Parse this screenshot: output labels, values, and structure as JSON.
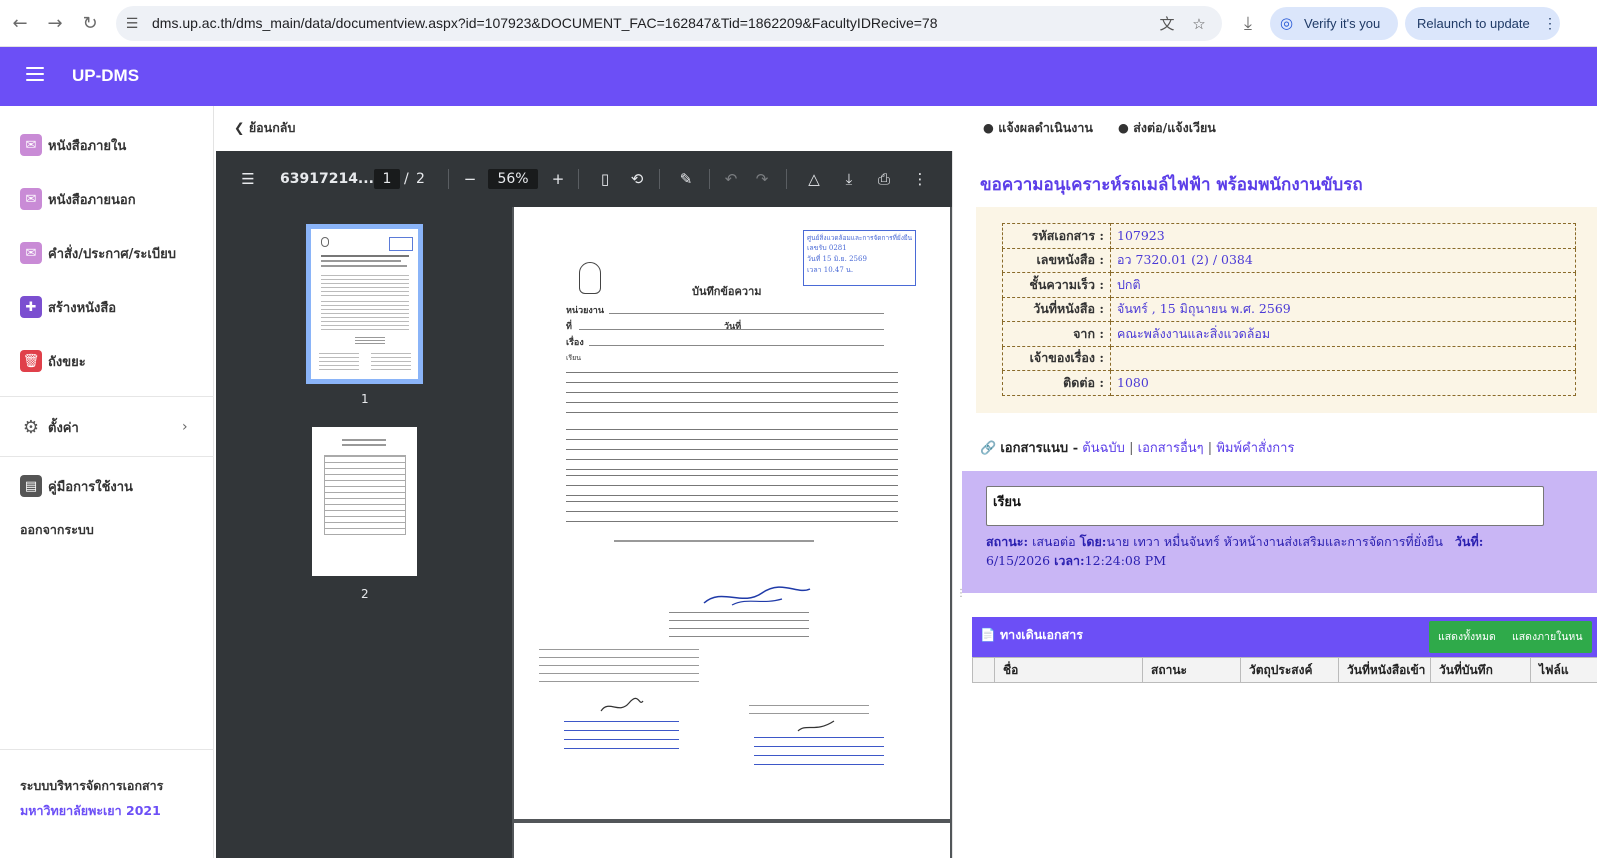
{
  "browser": {
    "url": "dms.up.ac.th/dms_main/data/documentview.aspx?id=107923&DOCUMENT_FAC=162847&Tid=1862209&FacultyIDRecive=78",
    "verify_label": "Verify it's you",
    "relaunch_label": "Relaunch to update",
    "icons": [
      "back-icon",
      "forward-icon",
      "reload-icon",
      "site-settings-icon",
      "translate-icon",
      "star-icon",
      "download-icon",
      "menu-kebab-icon"
    ]
  },
  "app": {
    "brand": "UP-DMS",
    "accent_color": "#6c4ff6"
  },
  "sidebar": {
    "items": [
      {
        "label": "หนังสือภายใน",
        "icon": "inbox-doc-icon"
      },
      {
        "label": "หนังสือภายนอก",
        "icon": "outbox-doc-icon"
      },
      {
        "label": "คำสั่ง/ประกาศ/ระเบียบ",
        "icon": "announcement-icon"
      },
      {
        "label": "สร้างหนังสือ",
        "icon": "create-doc-icon"
      },
      {
        "label": "ถังขยะ",
        "icon": "trash-icon"
      },
      {
        "label": "ตั้งค่า",
        "icon": "settings-icon"
      },
      {
        "label": "คู่มือการใช้งาน",
        "icon": "manual-icon"
      }
    ],
    "logout": "ออกจากระบบ",
    "footer_line1": "ระบบบริหารจัดการเอกสาร",
    "footer_line2": "มหาวิทยาลัยพะเยา 2021"
  },
  "toolbar": {
    "back": "ย้อนกลับ",
    "report": "แจ้งผลดำเนินงาน",
    "forward": "ส่งต่อ/แจ้งเวียน"
  },
  "pdf": {
    "filename": "63917214...",
    "page_current": "1",
    "page_total": "2",
    "zoom": "56%",
    "thumb_labels": [
      "1",
      "2"
    ]
  },
  "pdf_page": {
    "heading": "บันทึกข้อความ",
    "stamp_line1": "ศูนย์สิ่งแวดล้อมและการจัดการที่ยั่งยืน",
    "stamp_line2": "เลขรับ 0281",
    "stamp_line3": "วันที่ 15 มิ.ย. 2569",
    "stamp_line4": "เวลา 10.47 น.",
    "unit_label": "หน่วยงาน",
    "no_label": "ที่",
    "date_label": "วันที่",
    "subject_label": "เรื่อง",
    "to_label": "เรียน"
  },
  "detail": {
    "title": "ขอความอนุเคราะห์รถเมล์ไฟฟ้า พร้อมพนักงานขับรถ",
    "fields": [
      {
        "key": "รหัสเอกสาร :",
        "value": "107923"
      },
      {
        "key": "เลขหนังสือ :",
        "value": "อว 7320.01 (2) / 0384"
      },
      {
        "key": "ชั้นความเร็ว :",
        "value": "ปกติ"
      },
      {
        "key": "วันที่หนังสือ :",
        "value": "จันทร์ , 15 มิถุนายน พ.ศ. 2569"
      },
      {
        "key": "จาก :",
        "value": "คณะพลังงานและสิ่งแวดล้อม"
      },
      {
        "key": "เจ้าของเรื่อง :",
        "value": ""
      },
      {
        "key": "ติดต่อ :",
        "value": "1080"
      }
    ],
    "attach_label": "เอกสารแนบ -",
    "attach_links": [
      "ต้นฉบับ",
      "เอกสารอื่นๆ",
      "พิมพ์คำสั่งการ"
    ],
    "memo": "เรียน",
    "status_label": "สถานะ:",
    "status_value": "เสนอต่อ",
    "by_label": "โดย:",
    "by_value": "นาย เทวา หมื่นจันทร์ หัวหน้างานส่งเสริมและการจัดการที่ยั่งยืน",
    "date_label": "วันที่:",
    "date_value": "6/15/2026",
    "time_label": "เวลา:",
    "time_value": "12:24:08 PM",
    "route_title": "ทางเดินเอกสาร",
    "btn_show_all": "แสดงทั้งหมด",
    "btn_show_inside": "แสดงภายในหน",
    "columns": [
      "",
      "ชื่อ",
      "สถานะ",
      "วัตถุประสงค์",
      "วันที่หนังสือเข้า",
      "วันที่บันทึก",
      "ไฟล์แ"
    ]
  }
}
